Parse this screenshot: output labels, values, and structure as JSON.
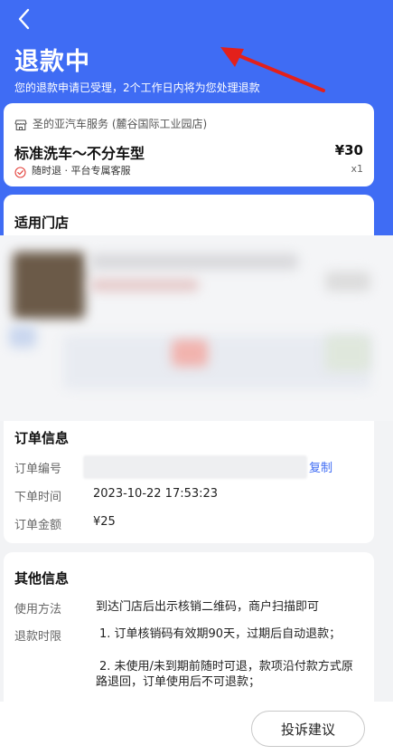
{
  "header": {
    "title": "退款中",
    "subtitle": "您的退款申请已受理，2个工作日内将为您处理退款"
  },
  "product": {
    "shop_name": "圣的亚汽车服务 (麓谷国际工业园店)",
    "name": "标准洗车～不分车型",
    "price": "¥30",
    "tag": "随时退 · 平台专属客服",
    "qty": "x1"
  },
  "store_section": {
    "title": "适用门店"
  },
  "order_info": {
    "title": "订单信息",
    "order_no_label": "订单编号",
    "copy_label": "复制",
    "time_label": "下单时间",
    "time_value": "2023-10-22 17:53:23",
    "amount_label": "订单金额",
    "amount_value": "¥25"
  },
  "other_info": {
    "title": "其他信息",
    "usage_label": "使用方法",
    "usage_value": "到达门店后出示核销二维码，商户扫描即可",
    "refund_label": "退款时限",
    "refund_line1": "1. 订单核销码有效期90天，过期后自动退款；",
    "refund_line2": "2. 未使用/未到期前随时可退，款项沿付款方式原路退回，订单使用后不可退款；"
  },
  "footer": {
    "complaint_label": "投诉建议"
  },
  "colors": {
    "brand_blue": "#3f6cf4",
    "annotation_red": "#e3201b"
  }
}
